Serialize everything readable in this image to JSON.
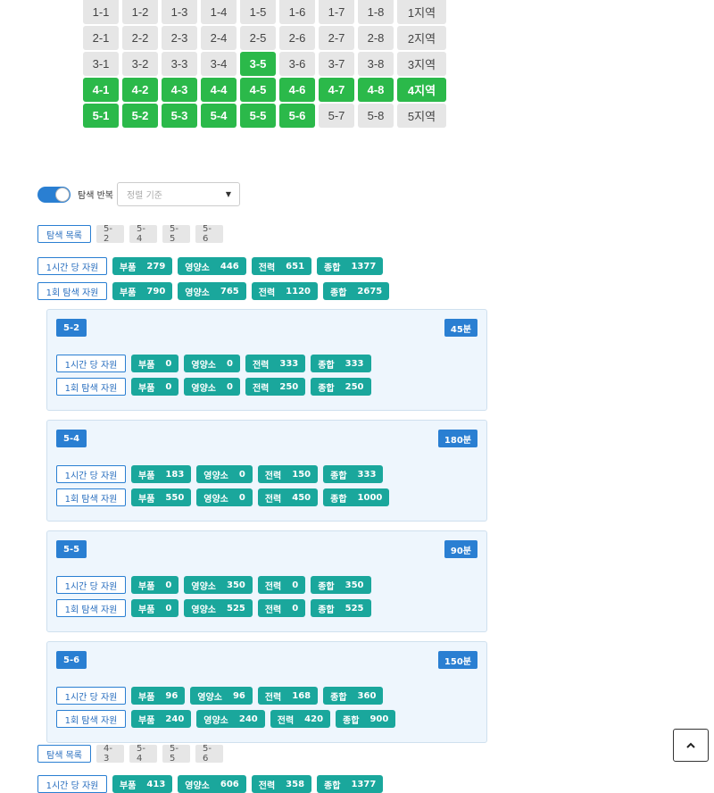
{
  "grid": {
    "rows": [
      {
        "cells": [
          {
            "label": "1-1",
            "on": false
          },
          {
            "label": "1-2",
            "on": false
          },
          {
            "label": "1-3",
            "on": false
          },
          {
            "label": "1-4",
            "on": false
          },
          {
            "label": "1-5",
            "on": false
          },
          {
            "label": "1-6",
            "on": false
          },
          {
            "label": "1-7",
            "on": false
          },
          {
            "label": "1-8",
            "on": false
          }
        ],
        "region": "1지역",
        "region_on": false
      },
      {
        "cells": [
          {
            "label": "2-1",
            "on": false
          },
          {
            "label": "2-2",
            "on": false
          },
          {
            "label": "2-3",
            "on": false
          },
          {
            "label": "2-4",
            "on": false
          },
          {
            "label": "2-5",
            "on": false
          },
          {
            "label": "2-6",
            "on": false
          },
          {
            "label": "2-7",
            "on": false
          },
          {
            "label": "2-8",
            "on": false
          }
        ],
        "region": "2지역",
        "region_on": false
      },
      {
        "cells": [
          {
            "label": "3-1",
            "on": false
          },
          {
            "label": "3-2",
            "on": false
          },
          {
            "label": "3-3",
            "on": false
          },
          {
            "label": "3-4",
            "on": false
          },
          {
            "label": "3-5",
            "on": true
          },
          {
            "label": "3-6",
            "on": false
          },
          {
            "label": "3-7",
            "on": false
          },
          {
            "label": "3-8",
            "on": false
          }
        ],
        "region": "3지역",
        "region_on": false
      },
      {
        "cells": [
          {
            "label": "4-1",
            "on": true
          },
          {
            "label": "4-2",
            "on": true
          },
          {
            "label": "4-3",
            "on": true
          },
          {
            "label": "4-4",
            "on": true
          },
          {
            "label": "4-5",
            "on": true
          },
          {
            "label": "4-6",
            "on": true
          },
          {
            "label": "4-7",
            "on": true
          },
          {
            "label": "4-8",
            "on": true
          }
        ],
        "region": "4지역",
        "region_on": true
      },
      {
        "cells": [
          {
            "label": "5-1",
            "on": true
          },
          {
            "label": "5-2",
            "on": true
          },
          {
            "label": "5-3",
            "on": true
          },
          {
            "label": "5-4",
            "on": true
          },
          {
            "label": "5-5",
            "on": true
          },
          {
            "label": "5-6",
            "on": true
          },
          {
            "label": "5-7",
            "on": false
          },
          {
            "label": "5-8",
            "on": false
          }
        ],
        "region": "5지역",
        "region_on": false
      }
    ]
  },
  "controls": {
    "toggle_label": "탐색 반복",
    "sort_placeholder": "정렬 기준",
    "toggle_on": true
  },
  "labels": {
    "list": "탐색 목록",
    "per_hour": "1시간 당 자원",
    "per_run": "1회 탐색 자원",
    "parts": "부품",
    "nutrient": "영양소",
    "power": "전력",
    "total": "종합"
  },
  "group1": {
    "chips": [
      "5-2",
      "5-4",
      "5-5",
      "5-6"
    ],
    "per_hour": {
      "parts": "279",
      "nutrient": "446",
      "power": "651",
      "total": "1377"
    },
    "per_run": {
      "parts": "790",
      "nutrient": "765",
      "power": "1120",
      "total": "2675"
    },
    "panels": [
      {
        "name": "5-2",
        "time": "45분",
        "per_hour": {
          "parts": "0",
          "nutrient": "0",
          "power": "333",
          "total": "333"
        },
        "per_run": {
          "parts": "0",
          "nutrient": "0",
          "power": "250",
          "total": "250"
        }
      },
      {
        "name": "5-4",
        "time": "180분",
        "per_hour": {
          "parts": "183",
          "nutrient": "0",
          "power": "150",
          "total": "333"
        },
        "per_run": {
          "parts": "550",
          "nutrient": "0",
          "power": "450",
          "total": "1000"
        }
      },
      {
        "name": "5-5",
        "time": "90분",
        "per_hour": {
          "parts": "0",
          "nutrient": "350",
          "power": "0",
          "total": "350"
        },
        "per_run": {
          "parts": "0",
          "nutrient": "525",
          "power": "0",
          "total": "525"
        }
      },
      {
        "name": "5-6",
        "time": "150분",
        "per_hour": {
          "parts": "96",
          "nutrient": "96",
          "power": "168",
          "total": "360"
        },
        "per_run": {
          "parts": "240",
          "nutrient": "240",
          "power": "420",
          "total": "900"
        }
      }
    ]
  },
  "group2": {
    "chips": [
      "4-3",
      "5-4",
      "5-5",
      "5-6"
    ],
    "per_hour": {
      "parts": "413",
      "nutrient": "606",
      "power": "358",
      "total": "1377"
    }
  },
  "colors": {
    "accent": "#2a7fd2",
    "on": "#2bb94a",
    "teal": "#1aa79c"
  },
  "scroll_top_icon": "chevron-up-icon"
}
